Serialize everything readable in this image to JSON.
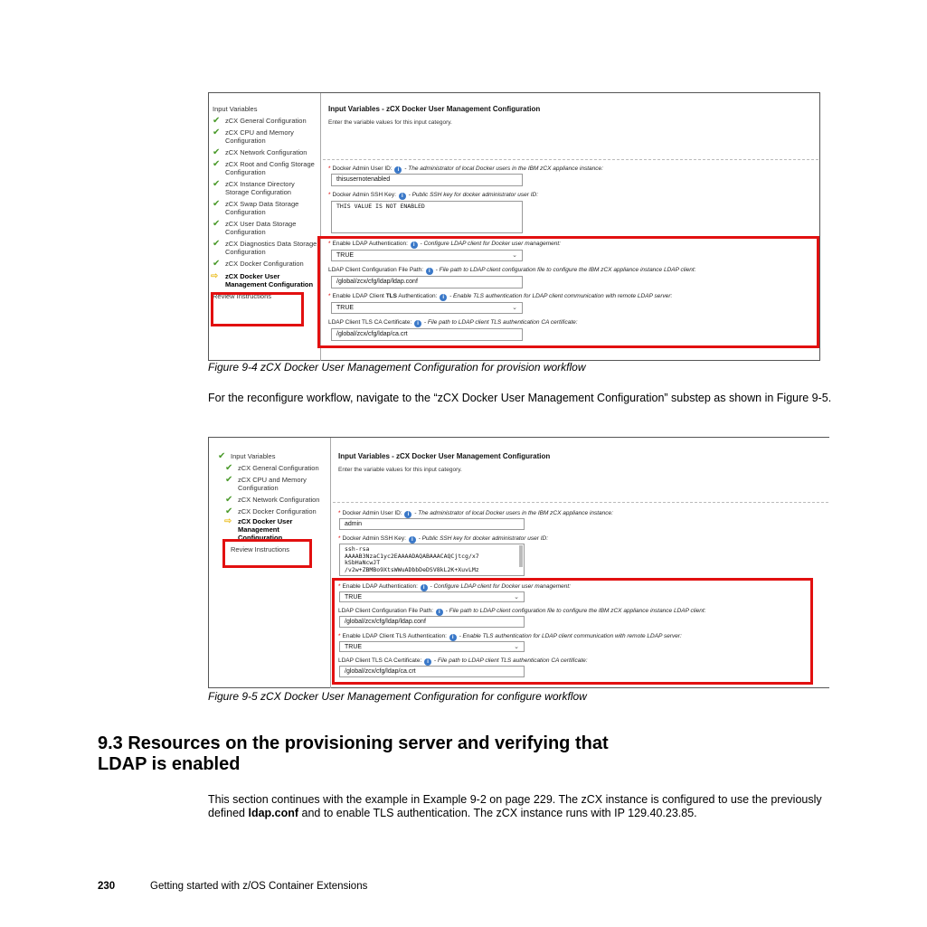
{
  "figure4": {
    "nav": {
      "header": "Input Variables",
      "items": [
        "zCX General Configuration",
        "zCX CPU and Memory Configuration",
        "zCX Network Configuration",
        "zCX Root and Config Storage Configuration",
        "zCX Instance Directory Storage Configuration",
        "zCX Swap Data Storage Configuration",
        "zCX User Data Storage Configuration",
        "zCX Diagnostics Data Storage Configuration",
        "zCX Docker Configuration"
      ],
      "active_item": "zCX Docker User Management Configuration",
      "footer": "Review Instructions"
    },
    "panel": {
      "title": "Input Variables - zCX Docker User Management Configuration",
      "description": "Enter the variable values for this input category."
    },
    "fields": {
      "admin_user_id_label": "Docker Admin User ID:",
      "admin_user_id_desc": "- The administrator of local Docker users in the IBM zCX appliance instance:",
      "admin_user_id_value": "thisusernotenabled",
      "ssh_key_label": "Docker Admin SSH Key:",
      "ssh_key_desc": "- Public SSH key for docker administrator user ID:",
      "ssh_key_value": "THIS VALUE IS NOT ENABLED",
      "ldap_auth_label": "Enable LDAP Authentication:",
      "ldap_auth_desc": "- Configure LDAP client for Docker user management:",
      "ldap_auth_value": "TRUE",
      "ldap_conf_label": "LDAP Client Configuration File Path:",
      "ldap_conf_desc": "- File path to LDAP client configuration file to configure the IBM zCX appliance instance LDAP client:",
      "ldap_conf_value": "/global/zcx/cfg/ldap/ldap.conf",
      "tls_auth_label_pre": "Enable LDAP Client",
      "tls_auth_label_bold": "TLS",
      "tls_auth_label_post": "Authentication:",
      "tls_auth_desc": "- Enable TLS authentication for LDAP client communication with remote LDAP server:",
      "tls_auth_value": "TRUE",
      "ca_cert_label": "LDAP Client TLS CA Certificate:",
      "ca_cert_desc": "- File path to LDAP client TLS authentication CA certificate:",
      "ca_cert_value": "/global/zcx/cfg/ldap/ca.crt"
    },
    "caption": "Figure 9-4   zCX Docker User Management Configuration for provision workflow"
  },
  "mid_text": "For the reconfigure workflow, navigate to the “zCX Docker User Management Configuration” substep as shown in Figure 9-5.",
  "figure5": {
    "nav": {
      "header": "Input Variables",
      "items": [
        "zCX General Configuration",
        "zCX CPU and Memory Configuration",
        "zCX Network Configuration",
        "zCX Docker Configuration"
      ],
      "active_item": "zCX Docker User Management Configuration",
      "footer": "Review Instructions"
    },
    "panel": {
      "title": "Input Variables - zCX Docker User Management Configuration",
      "description": "Enter the variable values for this input category."
    },
    "fields": {
      "admin_user_id_label": "Docker Admin User ID:",
      "admin_user_id_desc": "- The administrator of local Docker users in the IBM zCX appliance instance:",
      "admin_user_id_value": "admin",
      "ssh_key_label": "Docker Admin SSH Key:",
      "ssh_key_desc": "- Public SSH key for docker administrator user ID:",
      "ssh_key_value": "ssh-rsa\nAAAAB3NzaC1yc2EAAAADAQABAAACAQCjtcg/x7\nkSbHaNcwJT\n/v2w+ZBMBo9XtsWWuADbbDeDSV8kL2K+XuvLMz",
      "ldap_auth_label": "Enable LDAP Authentication:",
      "ldap_auth_desc": "- Configure LDAP client for Docker user management:",
      "ldap_auth_value": "TRUE",
      "ldap_conf_label": "LDAP Client Configuration File Path:",
      "ldap_conf_desc": "- File path to LDAP client configuration file to configure the IBM zCX appliance instance LDAP client:",
      "ldap_conf_value": "/global/zcx/cfg/ldap/ldap.conf",
      "tls_auth_label": "Enable LDAP Client TLS Authentication:",
      "tls_auth_desc": "- Enable TLS authentication for LDAP client communication with remote LDAP server:",
      "tls_auth_value": "TRUE",
      "ca_cert_label": "LDAP Client TLS CA Certificate:",
      "ca_cert_desc": "- File path to LDAP client TLS authentication CA certificate:",
      "ca_cert_value": "/global/zcx/cfg/ldap/ca.crt"
    },
    "caption": "Figure 9-5   zCX Docker User Management Configuration for configure workflow"
  },
  "section": {
    "heading_line1": "9.3  Resources on the provisioning server and verifying that",
    "heading_line2": "LDAP is enabled",
    "para_part1": "This section continues with the example in Example 9-2 on page 229. The zCX instance is configured to use the previously defined ",
    "para_bold": "ldap.conf",
    "para_part2": " and to enable TLS authentication. The zCX instance runs with IP 129.40.23.85."
  },
  "footer": {
    "page_number": "230",
    "book_title": "Getting started with z/OS Container Extensions"
  },
  "colors": {
    "highlight_red": "#e21010",
    "check_green": "#4a9a2a",
    "info_blue": "#3a78c8",
    "active_arrow": "#e8b400"
  }
}
